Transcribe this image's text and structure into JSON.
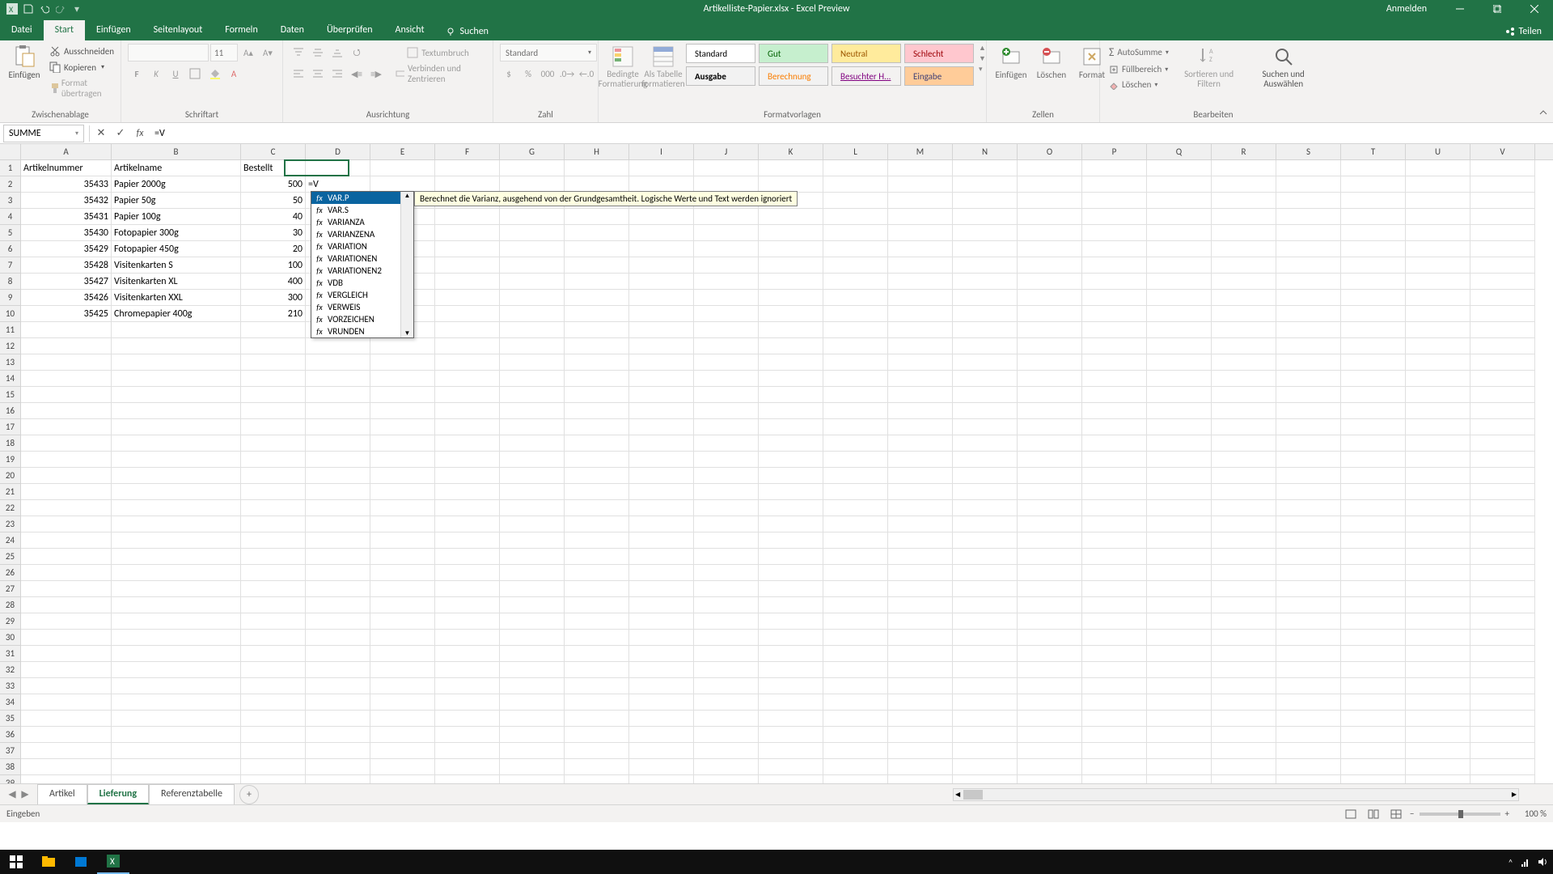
{
  "window": {
    "title": "Artikelliste-Papier.xlsx - Excel Preview",
    "signin": "Anmelden"
  },
  "tabs": {
    "file": "Datei",
    "items": [
      "Start",
      "Einfügen",
      "Seitenlayout",
      "Formeln",
      "Daten",
      "Überprüfen",
      "Ansicht"
    ],
    "active": "Start",
    "search": "Suchen",
    "share": "Teilen"
  },
  "ribbon": {
    "clipboard": {
      "paste": "Einfügen",
      "cut": "Ausschneiden",
      "copy": "Kopieren",
      "format": "Format übertragen",
      "label": "Zwischenablage"
    },
    "font": {
      "size": "11",
      "bold": "F",
      "italic": "K",
      "underline": "U",
      "label": "Schriftart"
    },
    "align": {
      "wrap": "Textumbruch",
      "merge": "Verbinden und Zentrieren",
      "label": "Ausrichtung"
    },
    "number": {
      "format": "Standard",
      "label": "Zahl"
    },
    "styles": {
      "cond": "Bedingte Formatierung",
      "table": "Als Tabelle formatieren",
      "standard": "Standard",
      "gut": "Gut",
      "neutral": "Neutral",
      "schlecht": "Schlecht",
      "ausgabe": "Ausgabe",
      "berechnung": "Berechnung",
      "besuchter": "Besuchter H...",
      "eingabe": "Eingabe",
      "label": "Formatvorlagen"
    },
    "cells": {
      "insert": "Einfügen",
      "delete": "Löschen",
      "format": "Format",
      "label": "Zellen"
    },
    "editing": {
      "autosum": "AutoSumme",
      "fill": "Füllbereich",
      "clear": "Löschen",
      "sort": "Sortieren und Filtern",
      "find": "Suchen und Auswählen",
      "label": "Bearbeiten"
    }
  },
  "formulabar": {
    "namebox": "SUMME",
    "formula": "=V"
  },
  "columns": [
    "A",
    "B",
    "C",
    "D",
    "E",
    "F",
    "G",
    "H",
    "I",
    "J",
    "K",
    "L",
    "M",
    "N",
    "O",
    "P",
    "Q",
    "R",
    "S",
    "T",
    "U",
    "V"
  ],
  "headers": {
    "A": "Artikelnummer",
    "B": "Artikelname",
    "C": "Bestellt"
  },
  "data": [
    {
      "num": "35433",
      "name": "Papier 2000g",
      "qty": "500"
    },
    {
      "num": "35432",
      "name": "Papier 50g",
      "qty": "50"
    },
    {
      "num": "35431",
      "name": "Papier 100g",
      "qty": "40"
    },
    {
      "num": "35430",
      "name": "Fotopapier 300g",
      "qty": "30"
    },
    {
      "num": "35429",
      "name": "Fotopapier 450g",
      "qty": "20"
    },
    {
      "num": "35428",
      "name": "Visitenkarten S",
      "qty": "100"
    },
    {
      "num": "35427",
      "name": "Visitenkarten XL",
      "qty": "400"
    },
    {
      "num": "35426",
      "name": "Visitenkarten XXL",
      "qty": "300"
    },
    {
      "num": "35425",
      "name": "Chromepapier 400g",
      "qty": "210"
    }
  ],
  "cell_editing": "=V",
  "autocomplete": {
    "items": [
      "VAR.P",
      "VAR.S",
      "VARIANZA",
      "VARIANZENA",
      "VARIATION",
      "VARIATIONEN",
      "VARIATIONEN2",
      "VDB",
      "VERGLEICH",
      "VERWEIS",
      "VORZEICHEN",
      "VRUNDEN"
    ],
    "selected": 0,
    "tip": "Berechnet die Varianz, ausgehend von der Grundgesamtheit. Logische Werte und Text werden ignoriert"
  },
  "sheets": {
    "items": [
      "Artikel",
      "Lieferung",
      "Referenztabelle"
    ],
    "active": "Lieferung"
  },
  "statusbar": {
    "mode": "Eingeben",
    "zoom": "100 %"
  },
  "colwidths": {
    "A": 112,
    "B": 160,
    "C": 80,
    "D": 80,
    "other": 80
  },
  "taskbar": {
    "time": ""
  }
}
